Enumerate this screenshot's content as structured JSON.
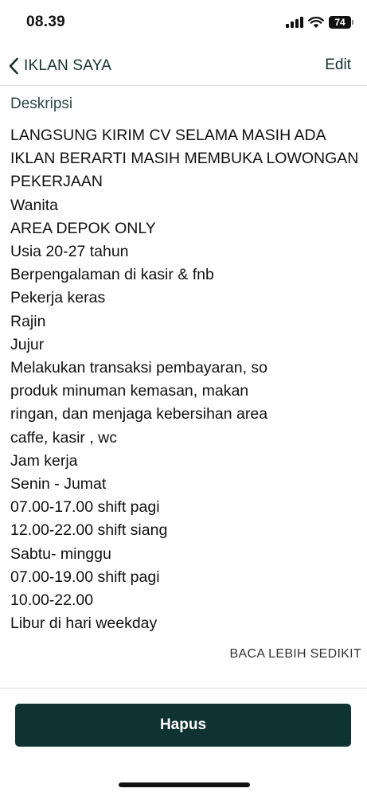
{
  "status_bar": {
    "time": "08.39",
    "battery": "74"
  },
  "nav": {
    "back_label": "IKLAN SAYA",
    "edit_label": "Edit"
  },
  "description": {
    "label": "Deskripsi",
    "lines": [
      "LANGSUNG KIRIM CV SELAMA MASIH ADA",
      "IKLAN BERARTI MASIH MEMBUKA LOWONGAN",
      "PEKERJAAN",
      "Wanita",
      "AREA DEPOK ONLY",
      "Usia 20-27 tahun",
      "Berpengalaman di kasir & fnb",
      "Pekerja keras",
      "Rajin",
      "Jujur",
      "Melakukan transaksi pembayaran, so",
      "produk minuman kemasan, makan",
      "ringan, dan menjaga kebersihan area",
      "caffe, kasir , wc",
      "Jam kerja",
      "Senin - Jumat",
      "07.00-17.00 shift pagi",
      "12.00-22.00 shift siang",
      "Sabtu- minggu",
      "07.00-19.00 shift pagi",
      "10.00-22.00",
      "Libur di hari weekday"
    ],
    "toggle_label": "BACA LEBIH SEDIKIT"
  },
  "actions": {
    "delete_label": "Hapus"
  },
  "colors": {
    "primary": "#0f3333",
    "nav_text": "#17302c"
  },
  "icons": {
    "back": "chevron-left-icon",
    "signal": "cellular-signal-icon",
    "wifi": "wifi-icon",
    "battery": "battery-icon"
  }
}
